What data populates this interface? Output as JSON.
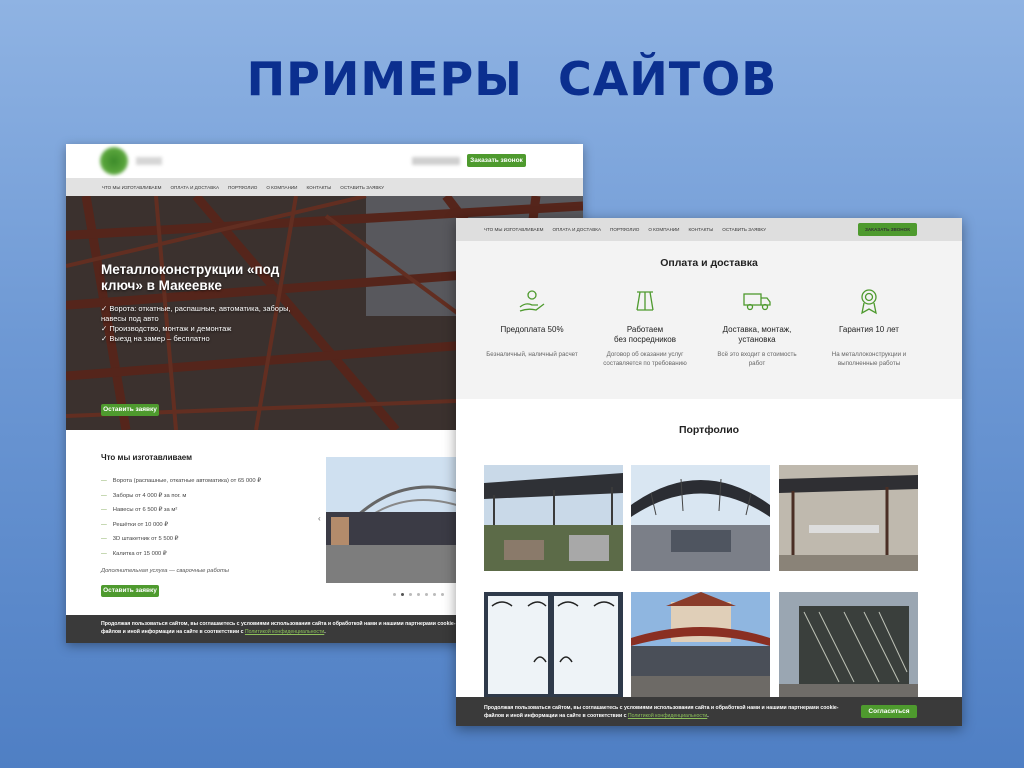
{
  "slide": {
    "title": "ПРИМЕРЫ САЙТОВ"
  },
  "site1": {
    "header": {
      "call_button": "Заказать звонок"
    },
    "nav": [
      "Что мы изготавливаем",
      "Оплата и доставка",
      "Портфолио",
      "О компании",
      "Контакты",
      "Оставить заявку"
    ],
    "hero": {
      "title": "Металлоконструкции «под ключ» в Макеевке",
      "bullets": [
        "✓ Ворота: откатные, распашные, автоматика, заборы, навесы под авто",
        "✓ Производство, монтаж и демонтаж",
        "✓ Выезд на замер – бесплатно"
      ],
      "button": "Оставить заявку"
    },
    "products": {
      "title": "Что мы изготавливаем",
      "items": [
        "Ворота (распашные, откатные автоматика) от 65 000 ₽",
        "Заборы от 4 000 ₽ за пог. м",
        "Навесы от 6 500 ₽ за м²",
        "Решётки от 10 000 ₽",
        "3D штакетник от 5 500 ₽",
        "Калитка от 15 000 ₽"
      ],
      "extra": "Дополнительная услуга — сварочные работы",
      "button": "Оставить заявку",
      "slider_prev": "‹",
      "dots_active": 2
    },
    "cookie": {
      "text1": "Продолжая пользоваться сайтом, вы соглашаетесь с условиями использования сайта и обработкой нами и нашими партнерами cookie-",
      "text2": "файлов и иной информации на сайте в соответствии с ",
      "link": "Политикой конфиденциальности",
      "end": "."
    }
  },
  "site2": {
    "nav": [
      "Что мы изготавливаем",
      "Оплата и доставка",
      "Портфолио",
      "О компании",
      "Контакты",
      "Оставить заявку"
    ],
    "call_button": "Заказать звонок",
    "payment": {
      "title": "Оплата и доставка",
      "features": [
        {
          "icon": "hand-coin-icon",
          "title": "Предоплата 50%",
          "desc": "Безналичный, наличный расчет"
        },
        {
          "icon": "steel-beam-icon",
          "title": "Работаем\nбез посредников",
          "desc": "Договор об оказании услуг\nсоставляется по требованию"
        },
        {
          "icon": "truck-icon",
          "title": "Доставка, монтаж,\nустановка",
          "desc": "Всё это входит в стоимость\nработ"
        },
        {
          "icon": "award-badge-icon",
          "title": "Гарантия 10 лет",
          "desc": "На металлоконструкции и\nвыполненные работы"
        }
      ]
    },
    "portfolio": {
      "title": "Портфолио"
    },
    "cookie": {
      "text1": "Продолжая пользоваться сайтом, вы соглашаетесь с условиями использования сайта и обработкой нами и нашими партнерами cookie-",
      "text2": "файлов и иной информации на сайте в соответствии с ",
      "link": "Политикой конфиденциальности",
      "end": ".",
      "button": "Согласиться"
    }
  },
  "colors": {
    "accent_green": "#4e9a2e",
    "title_blue": "#0b2f8f",
    "cookie_bg": "#3a3a3a"
  }
}
